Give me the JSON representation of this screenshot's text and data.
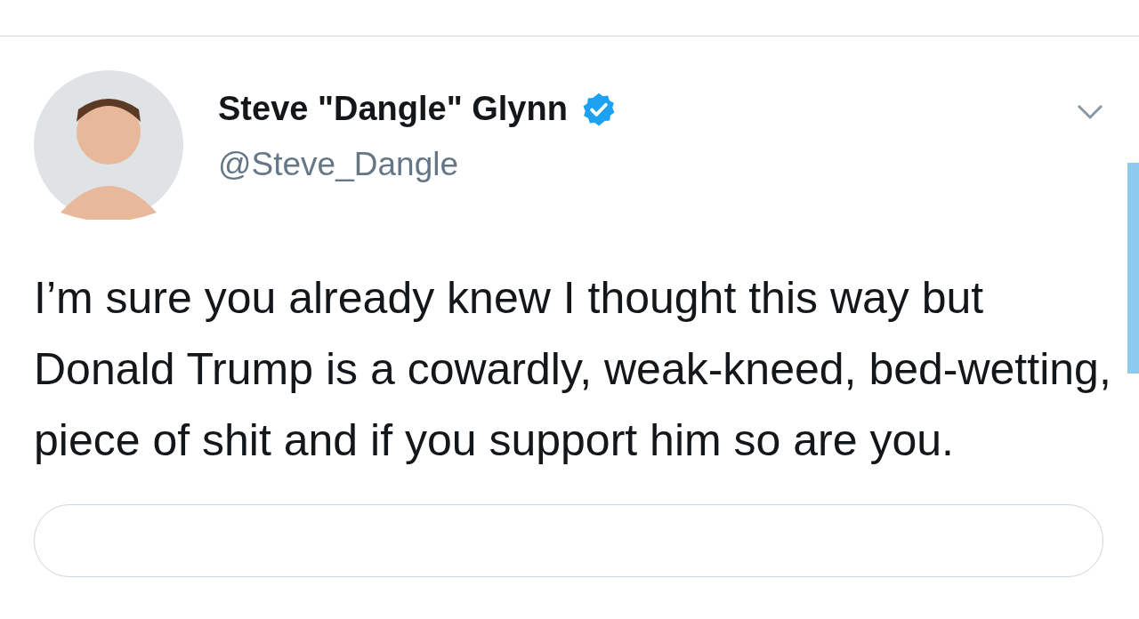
{
  "tweet": {
    "author": {
      "name": "Steve \"Dangle\" Glynn",
      "verified": true,
      "handle": "@Steve_Dangle"
    },
    "text": "I’m sure you already knew I thought this way but Donald Trump is a cowardly, weak-kneed, bed-wetting, piece of shit and if you support him so are you.",
    "quoted_card": {
      "kind": "card"
    }
  }
}
